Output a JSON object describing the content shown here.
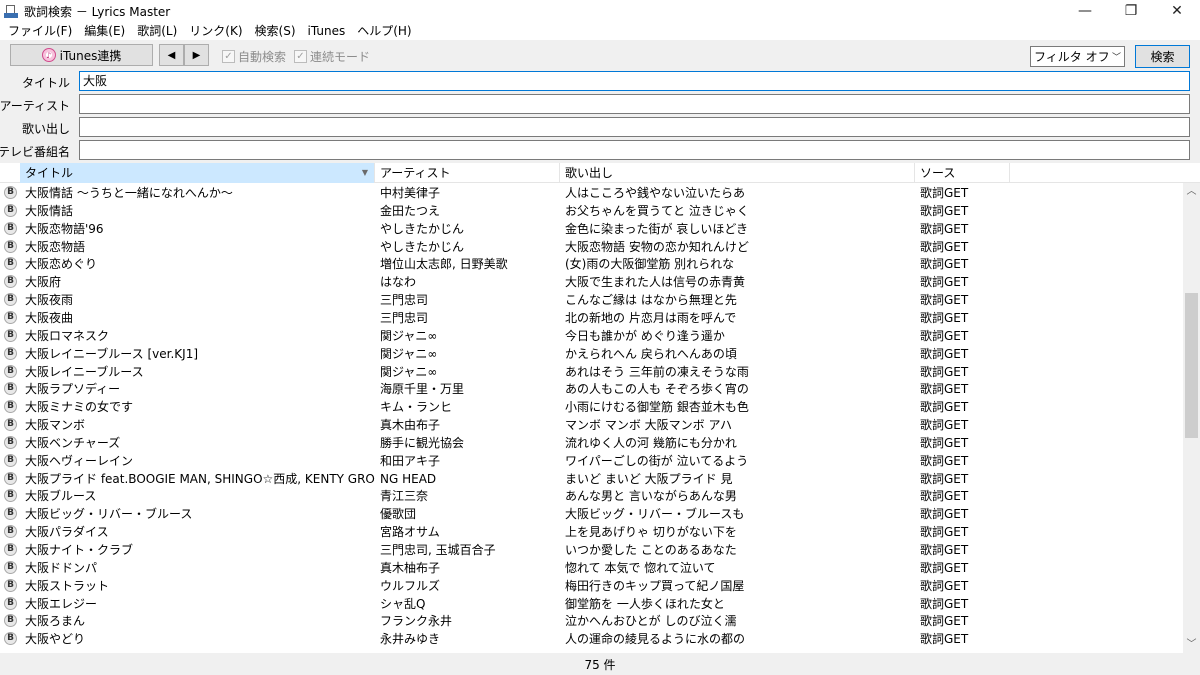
{
  "window": {
    "title": "歌詞検索 － Lyrics Master",
    "minimize": "—",
    "maximize": "❐",
    "close": "✕"
  },
  "menu": [
    "ファイル(F)",
    "編集(E)",
    "歌詞(L)",
    "リンク(K)",
    "検索(S)",
    "iTunes",
    "ヘルプ(H)"
  ],
  "toolbar": {
    "itunes_label": "iTunes連携",
    "prev": "◀",
    "next": "▶",
    "auto_search": "自動検索",
    "continuous_mode": "連続モード",
    "filter_value": "フィルタ オフ",
    "search_label": "検索"
  },
  "fields": {
    "title_label": "タイトル",
    "title_value": "大阪",
    "artist_label": "アーティスト",
    "artist_value": "",
    "lyric_label": "歌い出し",
    "lyric_value": "",
    "tv_label": "テレビ番組名",
    "tv_value": ""
  },
  "table": {
    "headers": {
      "title": "タイトル",
      "artist": "アーティスト",
      "lyric": "歌い出し",
      "source": "ソース"
    },
    "badge": "B",
    "rows": [
      {
        "title": "大阪情話 ～うちと一緒になれへんか～",
        "artist": "中村美律子",
        "lyric": "人はこころや銭やない泣いたらあ",
        "source": "歌詞GET"
      },
      {
        "title": "大阪情話",
        "artist": "金田たつえ",
        "lyric": "お父ちゃんを買うてと 泣きじゃく",
        "source": "歌詞GET"
      },
      {
        "title": "大阪恋物語'96",
        "artist": "やしきたかじん",
        "lyric": "金色に染まった街が 哀しいほどき",
        "source": "歌詞GET"
      },
      {
        "title": "大阪恋物語",
        "artist": "やしきたかじん",
        "lyric": "大阪恋物語 安物の恋か知れんけど",
        "source": "歌詞GET"
      },
      {
        "title": "大阪恋めぐり",
        "artist": "増位山太志郎, 日野美歌",
        "lyric": "(女)雨の大阪御堂筋 別れられな",
        "source": "歌詞GET"
      },
      {
        "title": "大阪府",
        "artist": "はなわ",
        "lyric": "大阪で生まれた人は信号の赤青黄",
        "source": "歌詞GET"
      },
      {
        "title": "大阪夜雨",
        "artist": "三門忠司",
        "lyric": "こんなご縁は はなから無理と先",
        "source": "歌詞GET"
      },
      {
        "title": "大阪夜曲",
        "artist": "三門忠司",
        "lyric": "北の新地の 片恋月は雨を呼んで",
        "source": "歌詞GET"
      },
      {
        "title": "大阪ロマネスク",
        "artist": "関ジャニ∞",
        "lyric": "今日も誰かが めぐり逢う遥か",
        "source": "歌詞GET"
      },
      {
        "title": "大阪レイニーブルース [ver.KJ1]",
        "artist": "関ジャニ∞",
        "lyric": "かえられへん 戻られへんあの頃",
        "source": "歌詞GET"
      },
      {
        "title": "大阪レイニーブルース",
        "artist": "関ジャニ∞",
        "lyric": "あれはそう 三年前の凍えそうな雨",
        "source": "歌詞GET"
      },
      {
        "title": "大阪ラプソディー",
        "artist": "海原千里・万里",
        "lyric": "あの人もこの人も そぞろ歩く宵の",
        "source": "歌詞GET"
      },
      {
        "title": "大阪ミナミの女です",
        "artist": "キム・ランヒ",
        "lyric": "小雨にけむる御堂筋 銀杏並木も色",
        "source": "歌詞GET"
      },
      {
        "title": "大阪マンボ",
        "artist": "真木由布子",
        "lyric": "マンボ マンボ 大阪マンボ アハ",
        "source": "歌詞GET"
      },
      {
        "title": "大阪ベンチャーズ",
        "artist": "勝手に観光協会",
        "lyric": "流れゆく人の河 幾筋にも分かれ",
        "source": "歌詞GET"
      },
      {
        "title": "大阪ヘヴィーレイン",
        "artist": "和田アキ子",
        "lyric": "ワイパーごしの街が 泣いてるよう",
        "source": "歌詞GET"
      },
      {
        "title": "大阪プライド feat.BOOGIE MAN, SHINGO☆西成, KENTY GROSS",
        "artist": "NG HEAD",
        "lyric": "まいど まいど 大阪プライド 見",
        "source": "歌詞GET"
      },
      {
        "title": "大阪ブルース",
        "artist": "青江三奈",
        "lyric": "あんな男と 言いながらあんな男",
        "source": "歌詞GET"
      },
      {
        "title": "大阪ビッグ・リバー・ブルース",
        "artist": "優歌団",
        "lyric": "大阪ビッグ・リバー・ブルースも",
        "source": "歌詞GET"
      },
      {
        "title": "大阪パラダイス",
        "artist": "宮路オサム",
        "lyric": "上を見あげりゃ 切りがない下を",
        "source": "歌詞GET"
      },
      {
        "title": "大阪ナイト・クラブ",
        "artist": "三門忠司, 玉城百合子",
        "lyric": "いつか愛した ことのあるあなた",
        "source": "歌詞GET"
      },
      {
        "title": "大阪ドドンパ",
        "artist": "真木柚布子",
        "lyric": "惚れて 本気で 惚れて泣いて",
        "source": "歌詞GET"
      },
      {
        "title": "大阪ストラット",
        "artist": "ウルフルズ",
        "lyric": "梅田行きのキップ買って紀ノ国屋",
        "source": "歌詞GET"
      },
      {
        "title": "大阪エレジー",
        "artist": "シャ乱Q",
        "lyric": "御堂筋を 一人歩くほれた女と",
        "source": "歌詞GET"
      },
      {
        "title": "大阪ろまん",
        "artist": "フランク永井",
        "lyric": "泣かへんおひとが しのび泣く濡",
        "source": "歌詞GET"
      },
      {
        "title": "大阪やどり",
        "artist": "永井みゆき",
        "lyric": "人の運命の綾見るように水の都の",
        "source": "歌詞GET"
      }
    ]
  },
  "status": {
    "count": "75 件"
  }
}
